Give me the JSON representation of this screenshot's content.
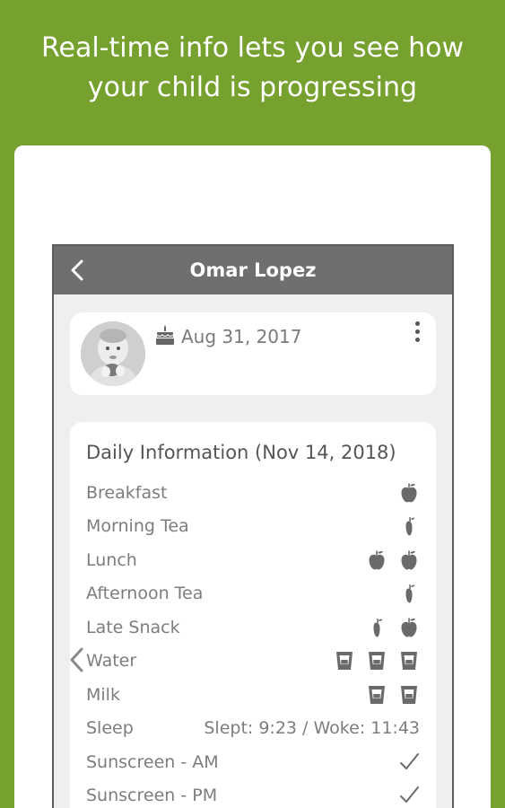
{
  "headline": {
    "line1": "Real-time info lets you see how",
    "line2": "your child is progressing"
  },
  "appbar": {
    "title": "Omar Lopez",
    "back_icon": "chevron-left-icon"
  },
  "profile": {
    "birth_date": "Aug 31, 2017",
    "birthday_icon": "cake-icon",
    "menu_icon": "more-vertical-icon"
  },
  "daily": {
    "title": "Daily Information (Nov 14, 2018)",
    "rows": [
      {
        "label": "Breakfast",
        "icons": [
          "apple-whole"
        ]
      },
      {
        "label": "Morning Tea",
        "icons": [
          "apple-half"
        ]
      },
      {
        "label": "Lunch",
        "icons": [
          "apple-whole",
          "apple-whole"
        ]
      },
      {
        "label": "Afternoon Tea",
        "icons": [
          "apple-half"
        ]
      },
      {
        "label": "Late Snack",
        "icons": [
          "apple-half",
          "apple-whole"
        ]
      },
      {
        "label": "Water",
        "icons": [
          "cup",
          "cup",
          "cup"
        ]
      },
      {
        "label": "Milk",
        "icons": [
          "cup",
          "cup"
        ]
      },
      {
        "label": "Sleep",
        "text": "Slept: 9:23 / Woke: 11:43"
      },
      {
        "label": "Sunscreen - AM",
        "icons": [
          "check"
        ]
      },
      {
        "label": "Sunscreen - PM",
        "icons": [
          "check"
        ]
      }
    ]
  },
  "colors": {
    "background": "#76a12f",
    "appbar": "#6f6f6f",
    "icon": "#6a6a6a"
  }
}
